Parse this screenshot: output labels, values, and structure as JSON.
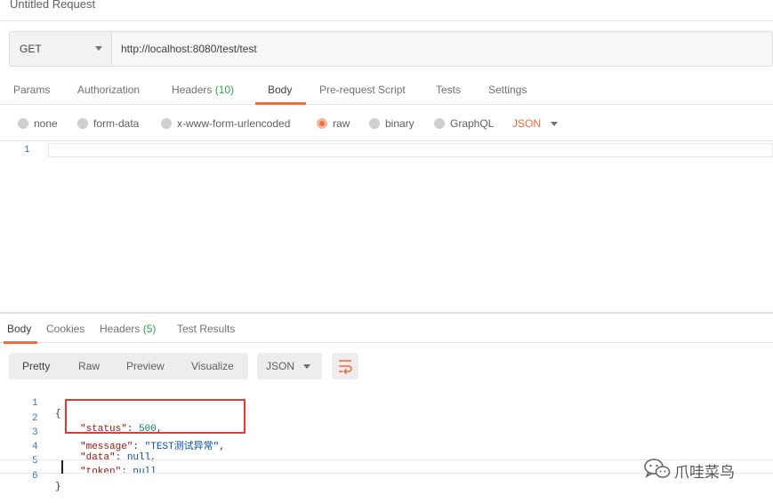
{
  "window": {
    "title": "Untitled Request"
  },
  "request": {
    "method": "GET",
    "url": "http://localhost:8080/test/test"
  },
  "request_tabs": [
    {
      "label": "Params"
    },
    {
      "label": "Authorization"
    },
    {
      "label": "Headers",
      "count": "(10)"
    },
    {
      "label": "Body"
    },
    {
      "label": "Pre-request Script"
    },
    {
      "label": "Tests"
    },
    {
      "label": "Settings"
    }
  ],
  "active_request_tab": "Body",
  "body_options": {
    "types": [
      "none",
      "form-data",
      "x-www-form-urlencoded",
      "raw",
      "binary",
      "GraphQL"
    ],
    "selected": "raw",
    "format": "JSON"
  },
  "request_editor": {
    "line_numbers": [
      "1"
    ]
  },
  "response_tabs": [
    {
      "label": "Body"
    },
    {
      "label": "Cookies"
    },
    {
      "label": "Headers",
      "count": "(5)"
    },
    {
      "label": "Test Results"
    }
  ],
  "active_response_tab": "Body",
  "response_toolbar": {
    "views": [
      "Pretty",
      "Raw",
      "Preview",
      "Visualize"
    ],
    "active_view": "Pretty",
    "format": "JSON",
    "wrap_icon": "wrap-lines-icon"
  },
  "response_body": {
    "line_numbers": [
      "1",
      "2",
      "3",
      "4",
      "5",
      "6"
    ],
    "open_brace": "{",
    "close_brace": "}",
    "fields": [
      {
        "key": "\"status\"",
        "value": "500",
        "type": "number",
        "suffix": ","
      },
      {
        "key": "\"message\"",
        "value": "\"TEST测试异常\"",
        "type": "string",
        "suffix": ","
      },
      {
        "key": "\"data\"",
        "value": "null",
        "type": "literal",
        "suffix": ","
      },
      {
        "key": "\"token\"",
        "value": "null",
        "type": "literal",
        "suffix": ""
      }
    ]
  },
  "annotation": {
    "color": "#e53935"
  },
  "watermark": {
    "text": "爪哇菜鸟",
    "icon": "wechat-icon"
  },
  "colors": {
    "accent": "#f26b3a",
    "count_green": "#2ea44f",
    "line_number": "#3a7ab8"
  }
}
